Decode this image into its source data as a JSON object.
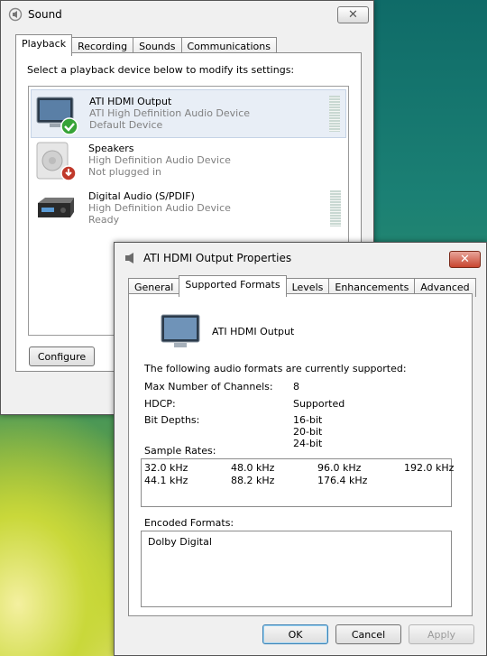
{
  "sound": {
    "title": "Sound",
    "tabs": [
      "Playback",
      "Recording",
      "Sounds",
      "Communications"
    ],
    "instruction": "Select a playback device below to modify its settings:",
    "devices": [
      {
        "name": "ATI HDMI Output",
        "driver": "ATI High Definition Audio Device",
        "status": "Default Device"
      },
      {
        "name": "Speakers",
        "driver": "High Definition Audio Device",
        "status": "Not plugged in"
      },
      {
        "name": "Digital Audio (S/PDIF)",
        "driver": "High Definition Audio Device",
        "status": "Ready"
      }
    ],
    "configure": "Configure"
  },
  "props": {
    "title": "ATI HDMI Output Properties",
    "tabs": [
      "General",
      "Supported Formats",
      "Levels",
      "Enhancements",
      "Advanced"
    ],
    "device_name": "ATI HDMI Output",
    "intro": "The following audio formats are currently supported:",
    "channels_label": "Max Number of Channels:",
    "channels_value": "8",
    "hdcp_label": "HDCP:",
    "hdcp_value": "Supported",
    "bitdepth_label": "Bit Depths:",
    "bitdepths": [
      "16-bit",
      "20-bit",
      "24-bit"
    ],
    "rates_label": "Sample Rates:",
    "rates": [
      "32.0 kHz",
      "48.0 kHz",
      "96.0 kHz",
      "192.0 kHz",
      "44.1 kHz",
      "88.2 kHz",
      "176.4 kHz"
    ],
    "encoded_label": "Encoded Formats:",
    "encoded": [
      "Dolby Digital"
    ],
    "ok": "OK",
    "cancel": "Cancel",
    "apply": "Apply"
  }
}
